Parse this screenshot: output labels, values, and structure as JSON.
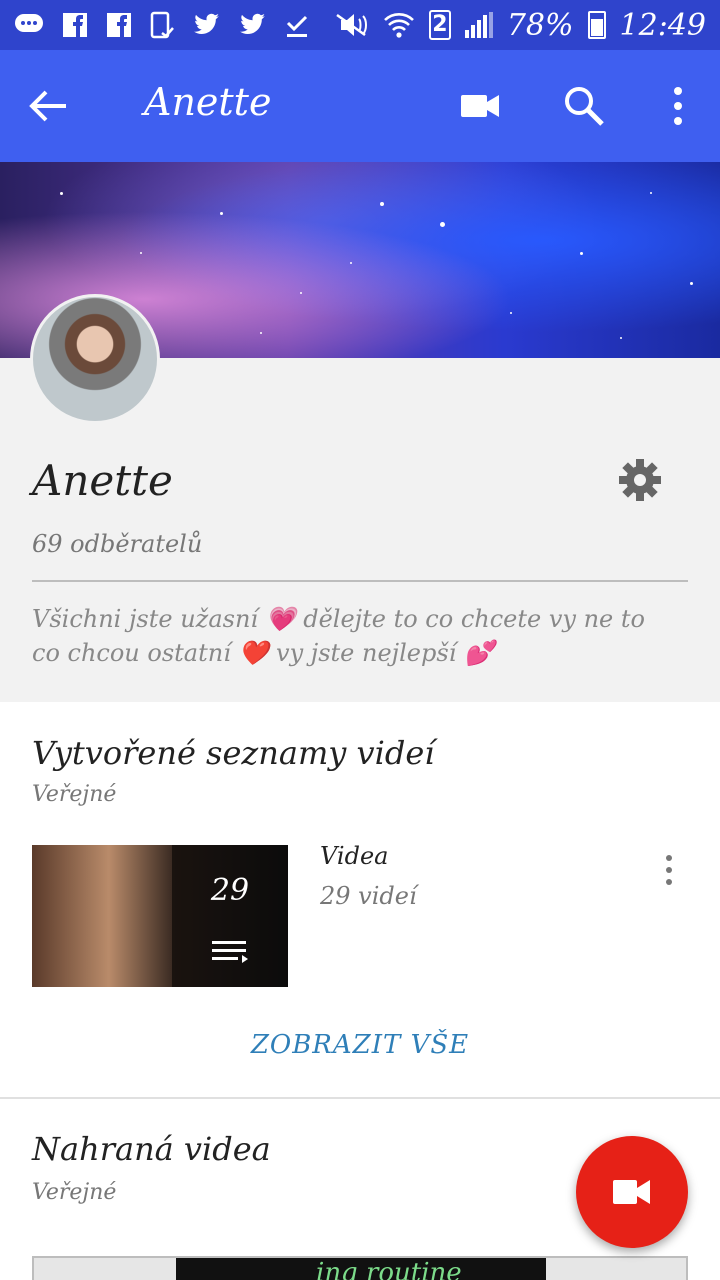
{
  "status_bar": {
    "icons": [
      "chat-icon",
      "facebook-icon",
      "facebook-icon",
      "phone-check-icon",
      "twitter-icon",
      "twitter-icon",
      "download-done-icon",
      "mute-icon",
      "wifi-icon",
      "sim-2-icon",
      "signal-icon"
    ],
    "sim_label": "2",
    "battery": "78%",
    "time": "12:49"
  },
  "app_bar": {
    "title": "Anette",
    "back_icon": "arrow-left-icon",
    "actions": [
      "videocam-icon",
      "search-icon",
      "more-vert-icon"
    ]
  },
  "profile": {
    "name": "Anette",
    "subscribers": "69 odběratelů",
    "bio_line1": "Všichni jste užasní 💗 dělejte to co chcete vy ne to",
    "bio_line2": "co chcou ostatní ❤️ vy jste nejlepší 💕",
    "settings_icon": "gear-icon"
  },
  "playlists_section": {
    "title": "Vytvořené seznamy videí",
    "visibility": "Veřejné",
    "item": {
      "thumb_count": "29",
      "title": "Videa",
      "count": "29 videí"
    },
    "show_all": "ZOBRAZIT VŠE"
  },
  "uploads_section": {
    "title": "Nahraná videa",
    "visibility": "Veřejné",
    "thumb_text": "ing routine"
  },
  "colors": {
    "status_bar": "#2f44cc",
    "app_bar": "#3f5ff0",
    "fab": "#e62117",
    "link": "#2f7fb8"
  }
}
